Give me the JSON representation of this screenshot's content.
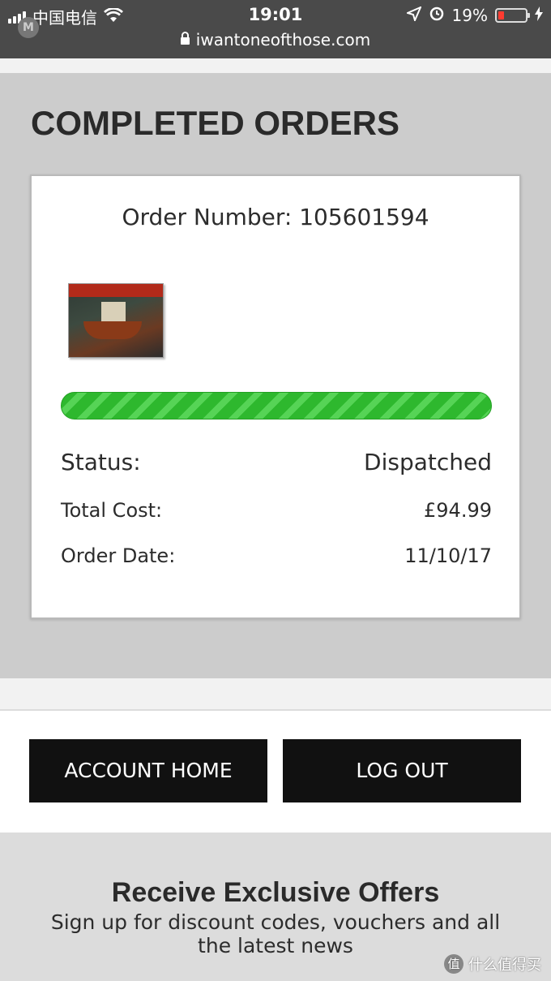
{
  "status_bar": {
    "carrier": "中国电信",
    "time": "19:01",
    "battery": "19%",
    "url": "iwantoneofthose.com"
  },
  "page": {
    "title": "COMPLETED ORDERS"
  },
  "order": {
    "number_label": "Order Number: 105601594",
    "progress": 1.0,
    "status_label": "Status:",
    "status_value": "Dispatched",
    "cost_label": "Total Cost:",
    "cost_value": "£94.99",
    "date_label": "Order Date:",
    "date_value": "11/10/17"
  },
  "actions": {
    "account_home": "ACCOUNT HOME",
    "log_out": "LOG OUT"
  },
  "newsletter": {
    "title": "Receive Exclusive Offers",
    "subtitle": "Sign up for discount codes, vouchers and all the latest news"
  },
  "watermark": {
    "text": "什么值得买"
  }
}
